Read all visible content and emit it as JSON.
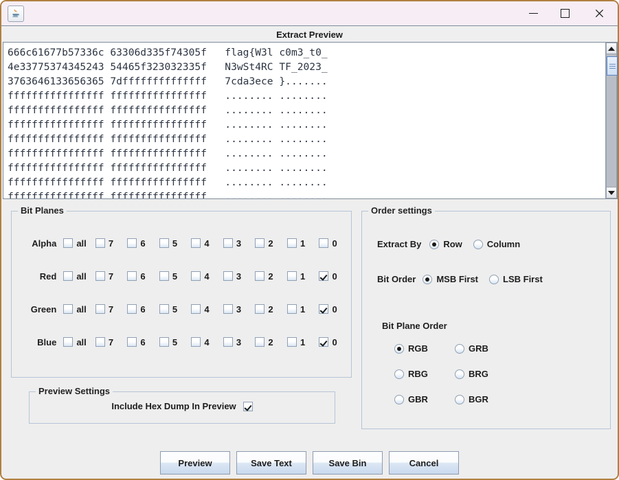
{
  "window": {
    "app_icon": "java-coffee-cup-icon",
    "minimize_label": "—",
    "maximize_label": "□",
    "close_label": "✕"
  },
  "dialog": {
    "title": "Extract Preview"
  },
  "preview": {
    "hex_lines": [
      "666c61677b57336c 63306d335f74305f   flag{W3l c0m3_t0_",
      "4e33775374345243 54465f323032335f   N3wSt4RC TF_2023_",
      "3763646133656365 7dffffffffffffff   7cda3ece }.......",
      "ffffffffffffffff ffffffffffffffff   ........ ........",
      "ffffffffffffffff ffffffffffffffff   ........ ........",
      "ffffffffffffffff ffffffffffffffff   ........ ........",
      "ffffffffffffffff ffffffffffffffff   ........ ........",
      "ffffffffffffffff ffffffffffffffff   ........ ........",
      "ffffffffffffffff ffffffffffffffff   ........ ........",
      "ffffffffffffffff ffffffffffffffff   ........ ........",
      "ffffffffffffffff ffffffffffffffff   ........ ........"
    ],
    "scroll_up_icon": "triangle-up-icon",
    "scroll_down_icon": "triangle-down-icon"
  },
  "bit_planes": {
    "title": "Bit Planes",
    "columns": [
      "all",
      "7",
      "6",
      "5",
      "4",
      "3",
      "2",
      "1",
      "0"
    ],
    "rows": [
      {
        "label": "Alpha",
        "checked": [
          false,
          false,
          false,
          false,
          false,
          false,
          false,
          false,
          false
        ]
      },
      {
        "label": "Red",
        "checked": [
          false,
          false,
          false,
          false,
          false,
          false,
          false,
          false,
          true
        ]
      },
      {
        "label": "Green",
        "checked": [
          false,
          false,
          false,
          false,
          false,
          false,
          false,
          false,
          true
        ]
      },
      {
        "label": "Blue",
        "checked": [
          false,
          false,
          false,
          false,
          false,
          false,
          false,
          false,
          true
        ]
      }
    ]
  },
  "order_settings": {
    "title": "Order settings",
    "extract_by": {
      "label": "Extract By",
      "options": [
        "Row",
        "Column"
      ],
      "selected": "Row"
    },
    "bit_order": {
      "label": "Bit Order",
      "options": [
        "MSB First",
        "LSB First"
      ],
      "selected": "MSB First"
    },
    "bit_plane_order": {
      "label": "Bit Plane Order",
      "options": [
        "RGB",
        "GRB",
        "RBG",
        "BRG",
        "GBR",
        "BGR"
      ],
      "selected": "RGB"
    }
  },
  "preview_settings": {
    "title": "Preview Settings",
    "include_hex_dump": {
      "label": "Include Hex Dump In Preview",
      "checked": true
    }
  },
  "buttons": [
    {
      "label": "Preview"
    },
    {
      "label": "Save Text"
    },
    {
      "label": "Save Bin"
    },
    {
      "label": "Cancel"
    }
  ],
  "colors": {
    "titlebar_bg": "#f6eef4",
    "window_border": "#b08040",
    "panel_bg": "#eeeeee",
    "panel_border": "#b6c4d6",
    "hex_text": "#2c3442",
    "scroll_thumb": "#cfe0f5"
  }
}
